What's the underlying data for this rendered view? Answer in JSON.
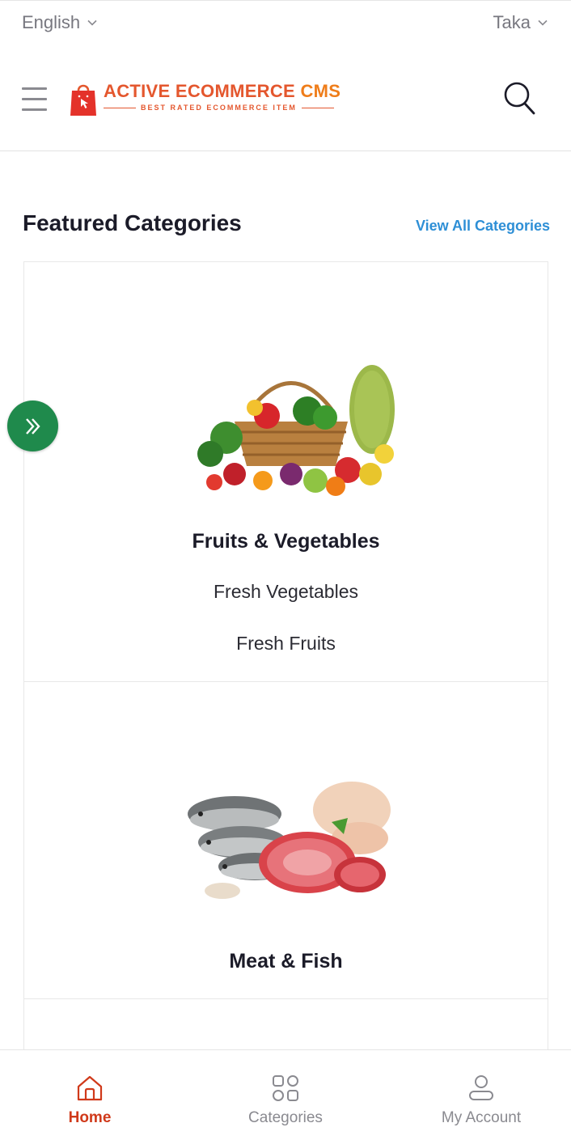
{
  "topbar": {
    "language": "English",
    "currency": "Taka",
    "icons": [
      "chevron-down-icon",
      "chevron-down-icon"
    ]
  },
  "header": {
    "menu_icon": "hamburger-menu-icon",
    "logo": {
      "title_part1": "ACTIVE ECOMMERCE",
      "title_part2": " CMS",
      "tagline": "BEST RATED ECOMMERCE ITEM"
    },
    "search_icon": "search-icon"
  },
  "featured": {
    "title": "Featured Categories",
    "view_all": "View All Categories",
    "categories": [
      {
        "name": "Fruits & Vegetables",
        "image_icon": "fruit-basket-image",
        "subcategories": [
          "Fresh Vegetables",
          "Fresh Fruits"
        ]
      },
      {
        "name": "Meat & Fish",
        "image_icon": "meat-fish-image",
        "subcategories": []
      },
      {
        "name": "",
        "image_icon": "grocery-pack-image",
        "subcategories": []
      }
    ]
  },
  "floating_button": {
    "icon": "double-chevron-right-icon"
  },
  "bottom_nav": {
    "items": [
      {
        "label": "Home",
        "icon": "home-icon",
        "active": true
      },
      {
        "label": "Categories",
        "icon": "grid-icon",
        "active": false
      },
      {
        "label": "My Account",
        "icon": "user-icon",
        "active": false
      }
    ]
  },
  "colors": {
    "accent": "#d0391a",
    "link": "#2e8fd6",
    "float_button": "#1f8a4c",
    "logo_red": "#e4572e",
    "logo_orange": "#ef7d1a"
  }
}
